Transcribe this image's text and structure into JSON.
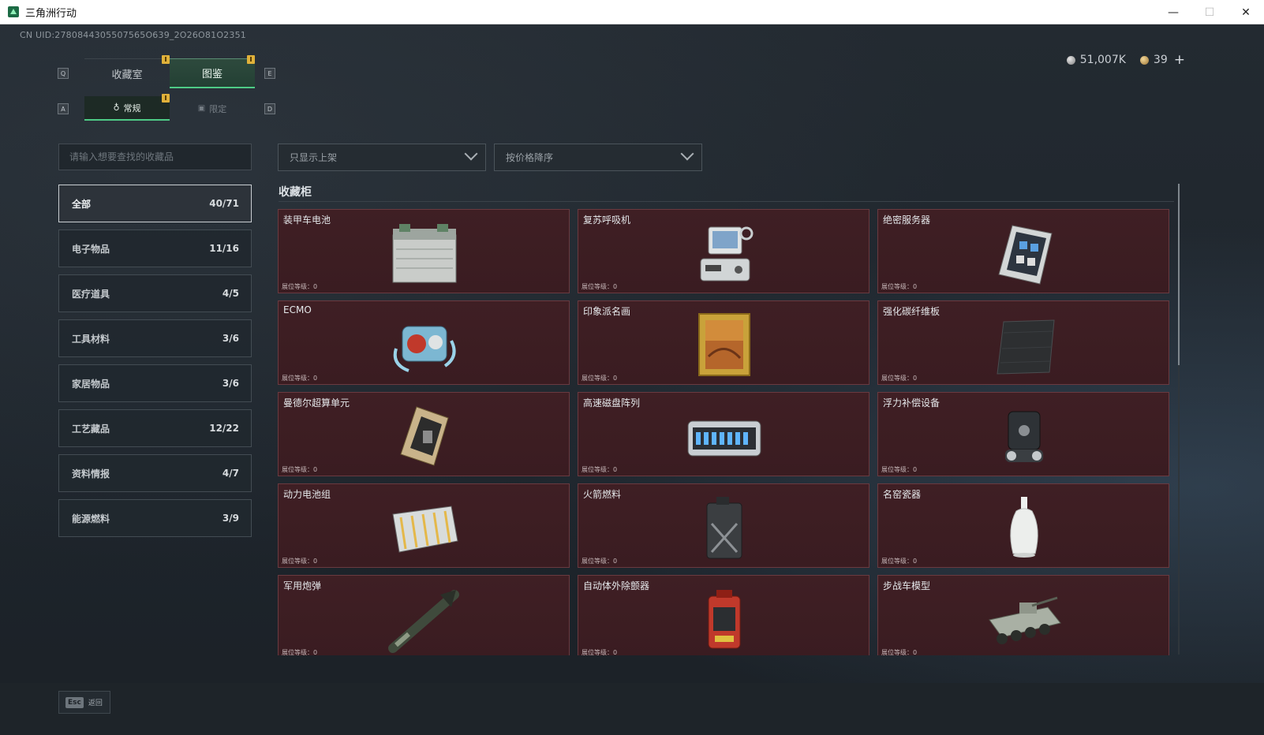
{
  "window": {
    "title": "三角洲行动",
    "controls": {
      "minimize": "—",
      "maximize": "☐",
      "close": "✕"
    }
  },
  "uid": "CN UID:2780844305507565O639_2O26O81O2351",
  "currency": {
    "silver": "51,007K",
    "gold": "39",
    "add": "+"
  },
  "keys": {
    "prev_tab": "Q",
    "next_tab": "E",
    "prev_sub": "A",
    "next_sub": "D"
  },
  "tabs": [
    {
      "label": "收藏室"
    },
    {
      "label": "图鉴"
    }
  ],
  "subtabs": [
    {
      "label": "常规"
    },
    {
      "label": "限定"
    }
  ],
  "search": {
    "placeholder": "请输入想要查找的收藏品"
  },
  "categories": [
    {
      "name": "全部",
      "count": "40/71"
    },
    {
      "name": "电子物品",
      "count": "11/16"
    },
    {
      "name": "医疗道具",
      "count": "4/5"
    },
    {
      "name": "工具材料",
      "count": "3/6"
    },
    {
      "name": "家居物品",
      "count": "3/6"
    },
    {
      "name": "工艺藏品",
      "count": "12/22"
    },
    {
      "name": "资料情报",
      "count": "4/7"
    },
    {
      "name": "能源燃料",
      "count": "3/9"
    }
  ],
  "filters": {
    "availability": "只显示上架",
    "sort": "按价格降序"
  },
  "section_title": "收藏柜",
  "level_label": "展位等级：0",
  "items": [
    {
      "name": "装甲车电池",
      "icon": "battery-icon"
    },
    {
      "name": "复苏呼吸机",
      "icon": "ventilator-icon"
    },
    {
      "name": "绝密服务器",
      "icon": "server-icon"
    },
    {
      "name": "ECMO",
      "icon": "ecmo-icon"
    },
    {
      "name": "印象派名画",
      "icon": "painting-icon"
    },
    {
      "name": "强化碳纤维板",
      "icon": "carbon-plate-icon"
    },
    {
      "name": "曼德尔超算单元",
      "icon": "compute-unit-icon"
    },
    {
      "name": "高速磁盘阵列",
      "icon": "disk-array-icon"
    },
    {
      "name": "浮力补偿设备",
      "icon": "bcd-icon"
    },
    {
      "name": "动力电池组",
      "icon": "battery-pack-icon"
    },
    {
      "name": "火箭燃料",
      "icon": "fuel-can-icon"
    },
    {
      "name": "名窑瓷器",
      "icon": "porcelain-icon"
    },
    {
      "name": "军用炮弹",
      "icon": "shell-icon"
    },
    {
      "name": "自动体外除颤器",
      "icon": "defibrillator-icon"
    },
    {
      "name": "步战车模型",
      "icon": "ifv-model-icon"
    }
  ],
  "footer": {
    "esc_key": "Esc",
    "back_label": "返回"
  }
}
